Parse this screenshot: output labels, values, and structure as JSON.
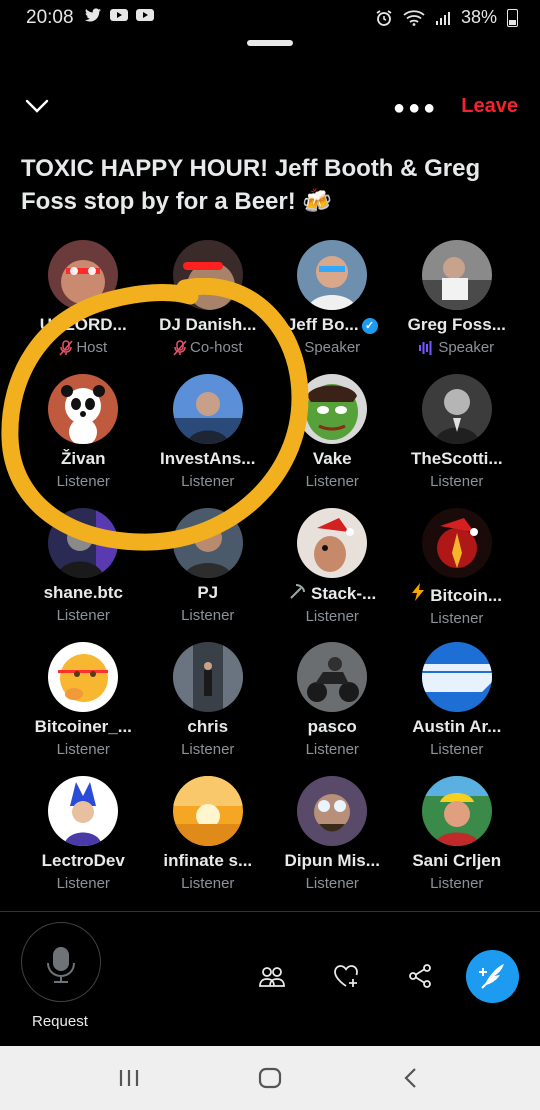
{
  "status_bar": {
    "time": "20:08",
    "battery": "38%"
  },
  "header": {
    "leave_label": "Leave"
  },
  "space": {
    "title": "TOXIC HAPPY HOUR!  Jeff Booth & Greg Foss stop by for a Beer! 🍻"
  },
  "participants": [
    {
      "name": "UBLORD...",
      "role": "Host",
      "role_icon": "muted-mic-icon"
    },
    {
      "name": "DJ Danish...",
      "role": "Co-host",
      "role_icon": "muted-mic-icon"
    },
    {
      "name": "Jeff Bo...",
      "role": "Speaker",
      "verified": true
    },
    {
      "name": "Greg Foss...",
      "role": "Speaker",
      "role_icon": "speaking-bars-icon"
    },
    {
      "name": "Živan",
      "role": "Listener"
    },
    {
      "name": "InvestAns...",
      "role": "Listener"
    },
    {
      "name": "Vake",
      "role": "Listener"
    },
    {
      "name": "TheScotti...",
      "role": "Listener"
    },
    {
      "name": "shane.btc",
      "role": "Listener"
    },
    {
      "name": "PJ",
      "role": "Listener"
    },
    {
      "name": "Stack-...",
      "role": "Listener",
      "prefix_icon": "pickaxe-icon"
    },
    {
      "name": "Bitcoin...",
      "role": "Listener",
      "prefix_icon": "lightning-icon"
    },
    {
      "name": "Bitcoiner_...",
      "role": "Listener"
    },
    {
      "name": "chris",
      "role": "Listener"
    },
    {
      "name": "pasco",
      "role": "Listener"
    },
    {
      "name": "Austin Ar...",
      "role": "Listener"
    },
    {
      "name": "LectroDev",
      "role": "Listener"
    },
    {
      "name": "infinate s...",
      "role": "Listener"
    },
    {
      "name": "Dipun Mis...",
      "role": "Listener"
    },
    {
      "name": "Sani Crljen",
      "role": "Listener"
    }
  ],
  "footer": {
    "request_label": "Request"
  },
  "colors": {
    "accent": "#1d9bf0",
    "leave": "#f4212e",
    "annotation": "#f2b01e",
    "muted_text": "#8b9299"
  }
}
